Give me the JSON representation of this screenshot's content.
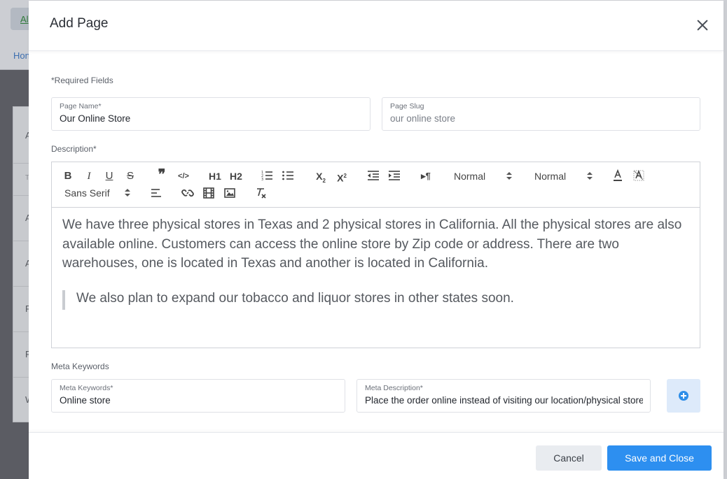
{
  "background": {
    "top_button_label": "Al",
    "breadcrumb_label": "Hon",
    "table_header": "T",
    "rows": [
      "A",
      "A",
      "F",
      "F",
      "W"
    ]
  },
  "modal": {
    "title": "Add Page",
    "close_icon": "close-icon",
    "required_note": "*Required Fields",
    "page_name": {
      "label": "Page Name*",
      "value": "Our Online Store"
    },
    "page_slug": {
      "label": "Page Slug",
      "value": "our online store"
    },
    "description": {
      "label": "Description*",
      "toolbar": {
        "bold": "B",
        "italic": "I",
        "underline": "U",
        "strike": "S",
        "quote": "❞",
        "code": "</>",
        "h1": "H1",
        "h2": "H2",
        "ordered_list_icon": "ordered-list-icon",
        "bullet_list_icon": "bullet-list-icon",
        "subscript": "X2",
        "superscript": "X2",
        "outdent_icon": "outdent-icon",
        "indent_icon": "indent-icon",
        "direction": "▸¶",
        "size_select": "Normal",
        "header_select": "Normal",
        "font_color_icon": "font-color-icon",
        "background_color_icon": "background-color-icon",
        "font_select": "Sans Serif",
        "align_icon": "align-icon",
        "link_icon": "link-icon",
        "video_icon": "video-icon",
        "image_icon": "image-icon",
        "clean_icon": "clear-format-icon"
      },
      "paragraph": "We have three physical stores in Texas and 2 physical stores in California. All the physical stores are also available online. Customers can access the online store by Zip code or address. There are two warehouses, one is located in Texas and another is located in California.",
      "quote": "We also plan to expand our tobacco and liquor stores in other states soon."
    },
    "meta_keywords_section": "Meta Keywords",
    "meta_keywords": {
      "label": "Meta Keywords*",
      "value": "Online store"
    },
    "meta_description": {
      "label": "Meta Description*",
      "value": "Place the order online instead of visiting our location/physical store"
    },
    "add_icon": "plus-circle-icon",
    "cancel_label": "Cancel",
    "save_label": "Save and Close"
  },
  "colors": {
    "primary": "#2d8ff0",
    "overlay": "#5f6066",
    "cancel_bg": "#e9ecf0",
    "add_bg": "#ddeafa"
  }
}
